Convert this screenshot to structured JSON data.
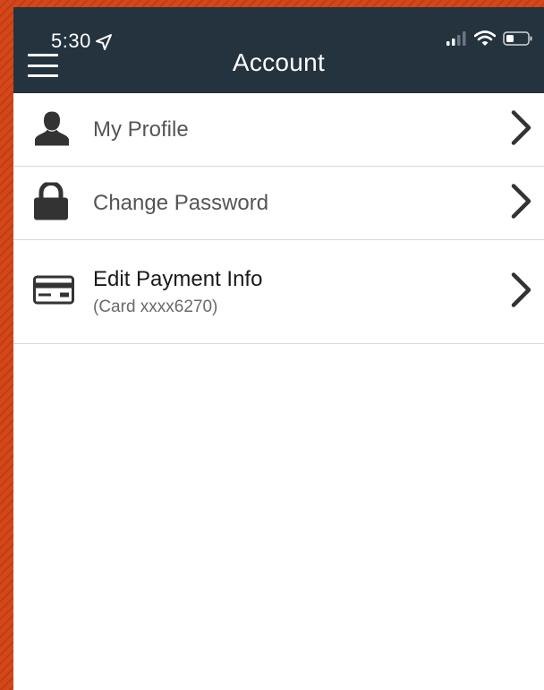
{
  "status_bar": {
    "time": "5:30"
  },
  "header": {
    "title": "Account"
  },
  "menu": {
    "items": [
      {
        "label": "My Profile",
        "icon": "user-icon"
      },
      {
        "label": "Change Password",
        "icon": "lock-icon"
      },
      {
        "label": "Edit Payment Info",
        "sublabel": "(Card xxxx6270)",
        "icon": "credit-card-icon"
      }
    ]
  },
  "colors": {
    "header_bg": "#25333f",
    "background_accent": "#d4471a",
    "icon": "#333333",
    "divider": "#d9d9d9"
  }
}
